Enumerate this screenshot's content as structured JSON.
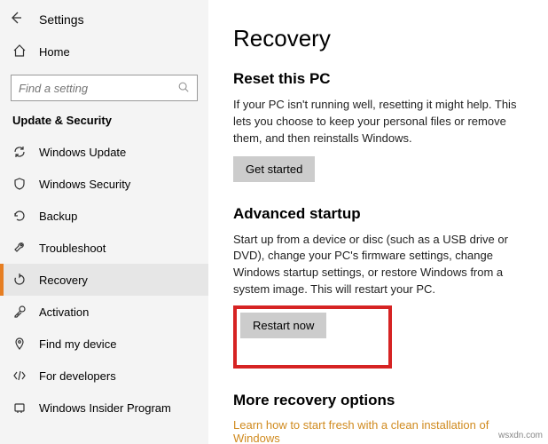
{
  "header": {
    "app_title": "Settings"
  },
  "home": {
    "label": "Home"
  },
  "search": {
    "placeholder": "Find a setting"
  },
  "section_header": "Update & Security",
  "sidebar": {
    "items": [
      {
        "label": "Windows Update"
      },
      {
        "label": "Windows Security"
      },
      {
        "label": "Backup"
      },
      {
        "label": "Troubleshoot"
      },
      {
        "label": "Recovery"
      },
      {
        "label": "Activation"
      },
      {
        "label": "Find my device"
      },
      {
        "label": "For developers"
      },
      {
        "label": "Windows Insider Program"
      }
    ]
  },
  "main": {
    "title": "Recovery",
    "reset": {
      "heading": "Reset this PC",
      "desc": "If your PC isn't running well, resetting it might help. This lets you choose to keep your personal files or remove them, and then reinstalls Windows.",
      "button": "Get started"
    },
    "advanced": {
      "heading": "Advanced startup",
      "desc": "Start up from a device or disc (such as a USB drive or DVD), change your PC's firmware settings, change Windows startup settings, or restore Windows from a system image. This will restart your PC.",
      "button": "Restart now"
    },
    "more": {
      "heading": "More recovery options",
      "link": "Learn how to start fresh with a clean installation of Windows"
    }
  },
  "watermark": "wsxdn.com"
}
